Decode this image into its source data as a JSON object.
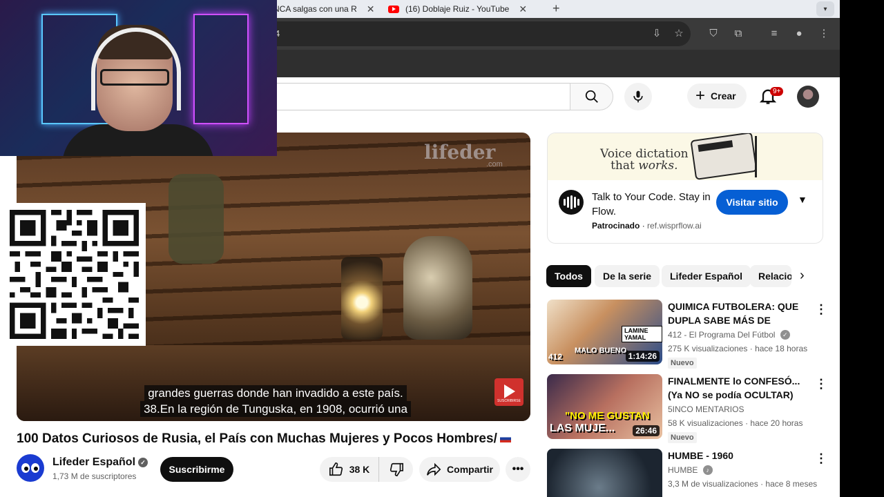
{
  "browser": {
    "tabs": [
      {
        "title": "NCA salgas con una R"
      },
      {
        "title": "(16) Doblaje Ruiz - YouTube"
      }
    ],
    "address_fragment": "4",
    "new_tab_symbol": "+",
    "close_symbol": "✕"
  },
  "header": {
    "create_label": "Crear",
    "notification_count": "9+"
  },
  "video": {
    "watermark": "lifeder",
    "watermark_sub": ".com",
    "caption_line1": "grandes guerras donde han invadido a este país.",
    "caption_line2": "38.En la región de Tunguska, en 1908, ocurrió una",
    "subscribe_logo_text": "SUSCRIBIRSE",
    "title": "100 Datos Curiosos de Rusia, el País con Muchas Mujeres y Pocos Hombres/",
    "channel_name": "Lifeder Español",
    "subscribers": "1,73 M de suscriptores",
    "subscribe_label": "Suscribirme",
    "like_count": "38 K",
    "share_label": "Compartir",
    "more_label": "•••"
  },
  "ad": {
    "headline_line1": "Voice dictation",
    "headline_line2_a": "that ",
    "headline_line2_b": "works.",
    "title": "Talk to Your Code. Stay in Flow.",
    "sponsored_label": "Patrocinado",
    "domain": "ref.wisprflow.ai",
    "cta_label": "Visitar sitio"
  },
  "chips": [
    {
      "label": "Todos",
      "active": true
    },
    {
      "label": "De la serie"
    },
    {
      "label": "Lifeder Español"
    },
    {
      "label": "Relacio"
    }
  ],
  "recommendations": [
    {
      "title": "QUIMICA FUTBOLERA: QUE DUPLA SABE MÁS DE FUTBOL...",
      "channel": "412 - El Programa Del Fútbol",
      "views": "275 K visualizaciones",
      "age": "hace 18 horas",
      "badge": "Nuevo",
      "duration": "1:14:26",
      "thumb_text_a": "LAMINE YAMAL",
      "thumb_text_b": "MALO BUENO",
      "thumb_text_c": "412"
    },
    {
      "title": "FINALMENTE lo CONFESÓ... (Ya NO se podía OCULTAR)",
      "channel": "5INCO MENTARIOS",
      "views": "58 K visualizaciones",
      "age": "hace 20 horas",
      "badge": "Nuevo",
      "duration": "26:46",
      "thumb_text_a": "\"NO ME GUSTAN",
      "thumb_text_b": "LAS MUJE..."
    },
    {
      "title": "HUMBE - 1960",
      "channel": "HUMBE",
      "views": "3,3 M de visualizaciones",
      "age": "hace 8 meses"
    }
  ],
  "colors": {
    "youtube_red": "#ff0000",
    "cta_blue": "#065fd4",
    "chip_active": "#0f0f0f"
  }
}
